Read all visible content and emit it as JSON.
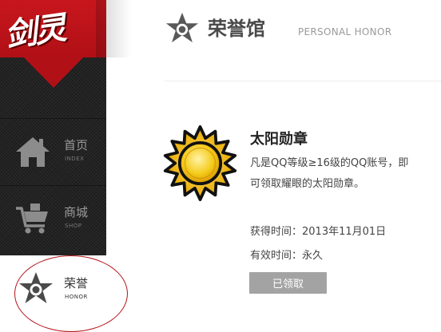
{
  "logo": {
    "text": "剑灵"
  },
  "sidebar": {
    "items": [
      {
        "label": "首页",
        "sub": "INDEX",
        "icon": "home-icon"
      },
      {
        "label": "商城",
        "sub": "SHOP",
        "icon": "cart-icon"
      },
      {
        "label": "荣誉",
        "sub": "HONOR",
        "icon": "star-badge-icon",
        "active": true
      }
    ]
  },
  "header": {
    "title": "荣誉馆",
    "subtitle": "PERSONAL HONOR",
    "icon": "star-badge-icon"
  },
  "medal": {
    "icon": "sun-medal-icon",
    "title": "太阳勋章",
    "description": "凡是QQ等级≥16级的QQ账号，即可领取耀眼的太阳勋章。",
    "obtained_time": "获得时间：2013年11月01日",
    "valid_time": "有效时间：永久",
    "button_label": "已领取"
  },
  "colors": {
    "brand_red": "#c8161d",
    "sidebar_bg": "#232323",
    "button_gray": "#a3a3a3",
    "medal_gold": "#f2c40f",
    "annotation_red": "#b5141a"
  }
}
